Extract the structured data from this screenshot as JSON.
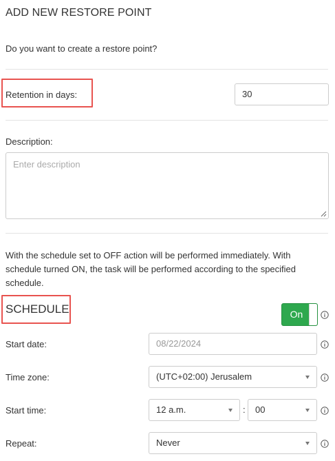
{
  "dialog": {
    "title": "ADD NEW RESTORE POINT",
    "question": "Do you want to create a restore point?"
  },
  "retention": {
    "label": "Retention in days:",
    "value": "30"
  },
  "description": {
    "label": "Description:",
    "placeholder": "Enter description"
  },
  "schedule_note": {
    "text": "With the schedule set to OFF action will be performed immediately. With schedule turned ON, the task will be performed according to the specified schedule."
  },
  "schedule": {
    "title": "SCHEDULE",
    "toggle_label": "On",
    "toggle_state": "on",
    "toggle_color": "#2ea84e",
    "start_date": {
      "label": "Start date:",
      "value": "08/22/2024"
    },
    "time_zone": {
      "label": "Time zone:",
      "value": "(UTC+02:00) Jerusalem"
    },
    "start_time": {
      "label": "Start time:",
      "hour": "12 a.m.",
      "separator": ":",
      "minute": "00"
    },
    "repeat": {
      "label": "Repeat:",
      "value": "Never"
    }
  },
  "icons": {
    "info": "info-icon",
    "caret": "chevron-down-icon",
    "resize": "resize-grip-icon"
  },
  "highlight_color": "#e8534f"
}
